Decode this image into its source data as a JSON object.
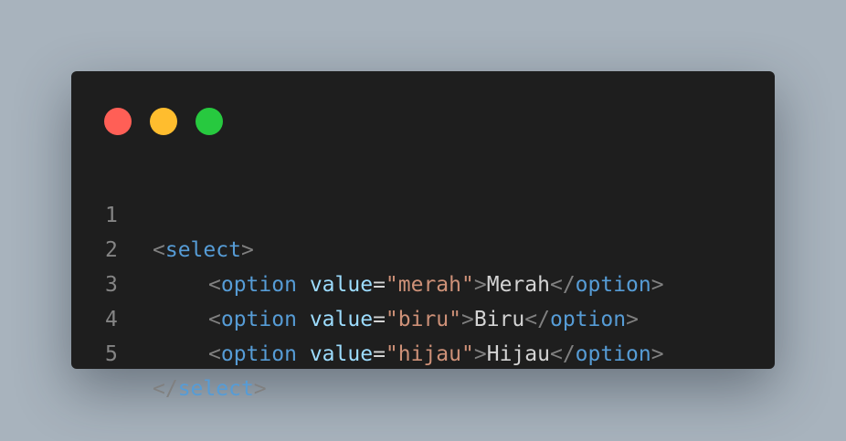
{
  "window": {
    "controls": [
      {
        "name": "close",
        "color": "#ff5f56"
      },
      {
        "name": "minimize",
        "color": "#ffbd2e"
      },
      {
        "name": "maximize",
        "color": "#27c93f"
      }
    ]
  },
  "code": {
    "lines": [
      {
        "number": "1",
        "lt": "<",
        "tag": "select",
        "gt": ">"
      },
      {
        "number": "2",
        "lt": "<",
        "tag": "option",
        "attr": "value",
        "eq": "=",
        "value": "\"merah\"",
        "gt": ">",
        "text": "Merah",
        "close_lt": "</",
        "close_tag": "option",
        "close_gt": ">"
      },
      {
        "number": "3",
        "lt": "<",
        "tag": "option",
        "attr": "value",
        "eq": "=",
        "value": "\"biru\"",
        "gt": ">",
        "text": "Biru",
        "close_lt": "</",
        "close_tag": "option",
        "close_gt": ">"
      },
      {
        "number": "4",
        "lt": "<",
        "tag": "option",
        "attr": "value",
        "eq": "=",
        "value": "\"hijau\"",
        "gt": ">",
        "text": "Hijau",
        "close_lt": "</",
        "close_tag": "option",
        "close_gt": ">"
      },
      {
        "number": "5",
        "lt": "</",
        "tag": "select",
        "gt": ">"
      }
    ]
  }
}
